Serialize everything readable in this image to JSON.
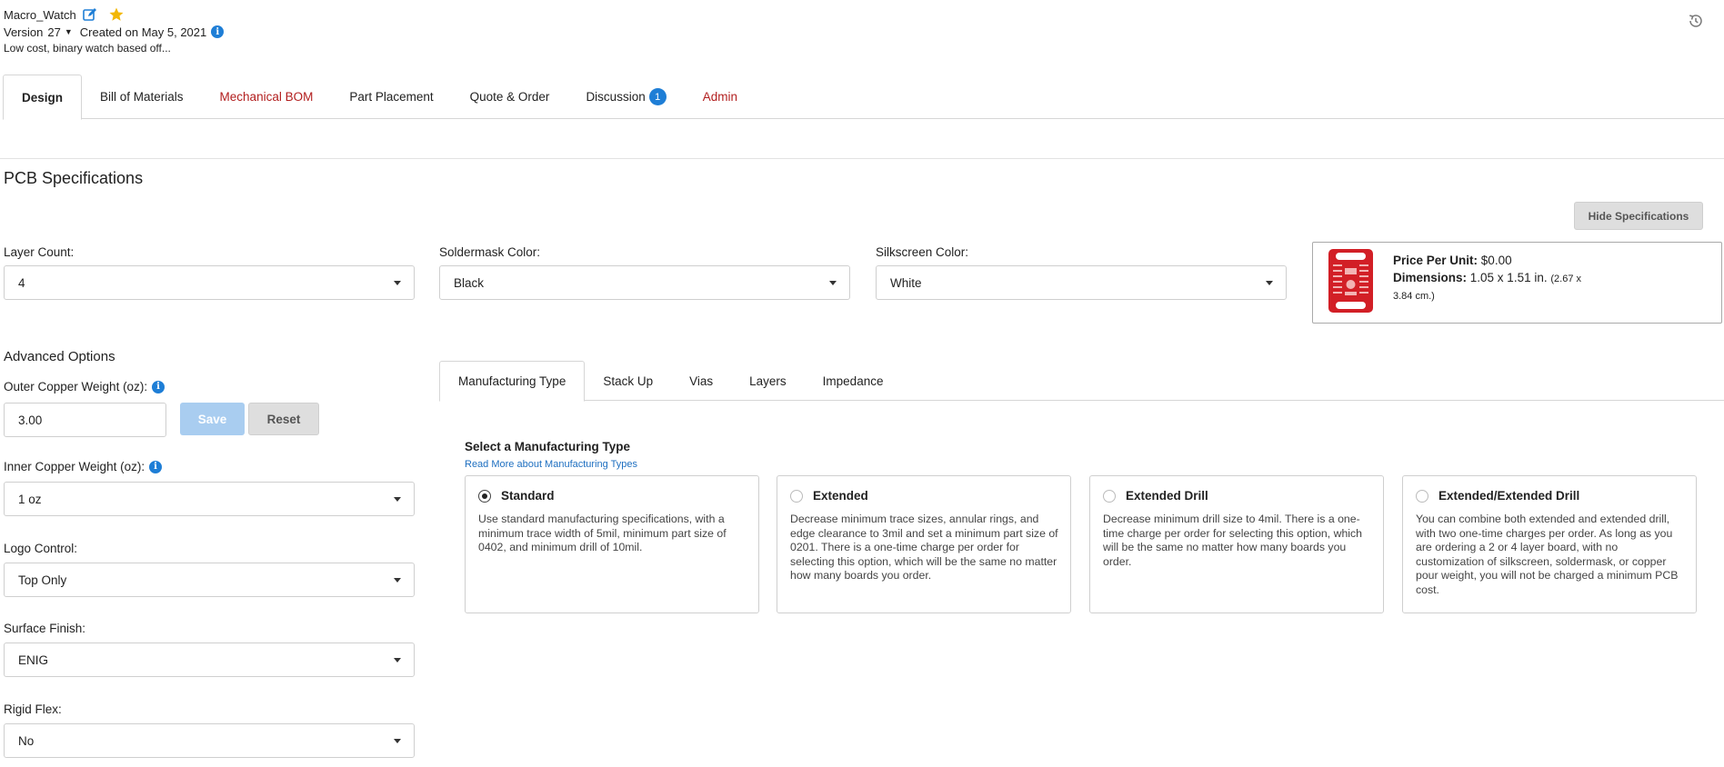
{
  "header": {
    "project_name": "Macro_Watch",
    "version_label": "Version",
    "version_number": "27",
    "created": "Created on May 5, 2021",
    "description": "Low cost, binary watch based off..."
  },
  "tabs": [
    {
      "label": "Design",
      "active": true
    },
    {
      "label": "Bill of Materials"
    },
    {
      "label": "Mechanical BOM"
    },
    {
      "label": "Part Placement"
    },
    {
      "label": "Quote & Order"
    },
    {
      "label": "Discussion",
      "badge": "1"
    },
    {
      "label": "Admin"
    }
  ],
  "pcb": {
    "title": "PCB Specifications",
    "hide_button": "Hide Specifications",
    "layer_count_label": "Layer Count:",
    "layer_count_value": "4",
    "soldermask_label": "Soldermask Color:",
    "soldermask_value": "Black",
    "silkscreen_label": "Silkscreen Color:",
    "silkscreen_value": "White",
    "price_label": "Price Per Unit:",
    "price_value": "$0.00",
    "dimensions_label": "Dimensions:",
    "dimensions_value": "1.05 x 1.51 in.",
    "dimensions_cm_1": "(2.67 x",
    "dimensions_cm_2": "3.84 cm.)"
  },
  "advanced": {
    "title": "Advanced Options",
    "outer_copper_label": "Outer Copper Weight (oz):",
    "outer_copper_value": "3.00",
    "save_button": "Save",
    "reset_button": "Reset",
    "inner_copper_label": "Inner Copper Weight (oz):",
    "inner_copper_value": "1 oz",
    "logo_label": "Logo Control:",
    "logo_value": "Top Only",
    "surface_label": "Surface Finish:",
    "surface_value": "ENIG",
    "rigid_label": "Rigid Flex:",
    "rigid_value": "No"
  },
  "sub_tabs": [
    {
      "label": "Manufacturing Type",
      "active": true
    },
    {
      "label": "Stack Up"
    },
    {
      "label": "Vias"
    },
    {
      "label": "Layers"
    },
    {
      "label": "Impedance"
    }
  ],
  "manufacturing": {
    "title": "Select a Manufacturing Type",
    "link": "Read More about Manufacturing Types",
    "options": [
      {
        "title": "Standard",
        "selected": true,
        "body": "Use standard manufacturing specifications, with a minimum trace width of 5mil, minimum part size of 0402, and minimum drill of 10mil."
      },
      {
        "title": "Extended",
        "selected": false,
        "body": "Decrease minimum trace sizes, annular rings, and edge clearance to 3mil and set a minimum part size of 0201. There is a one-time charge per order for selecting this option, which will be the same no matter how many boards you order."
      },
      {
        "title": "Extended Drill",
        "selected": false,
        "body": "Decrease minimum drill size to 4mil. There is a one-time charge per order for selecting this option, which will be the same no matter how many boards you order."
      },
      {
        "title": "Extended/Extended Drill",
        "selected": false,
        "body": "You can combine both extended and extended drill, with two one-time charges per order. As long as you are ordering a 2 or 4 layer board, with no customization of silkscreen, soldermask, or copper pour weight, you will not be charged a minimum PCB cost."
      }
    ]
  },
  "colors": {
    "accent_blue": "#1e7ed6",
    "link_blue": "#1e6fc0",
    "warning_red": "#b21e1e",
    "pcb_red": "#d21f26",
    "star_yellow": "#f2b705"
  }
}
